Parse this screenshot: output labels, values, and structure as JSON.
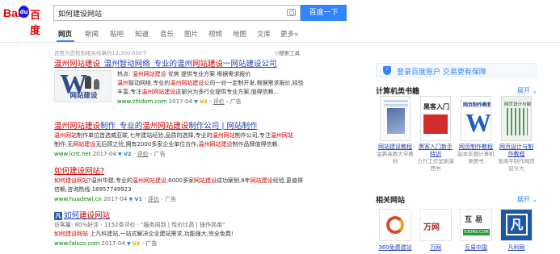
{
  "header": {
    "logo_left": "Bai",
    "logo_paw": "du",
    "logo_right": "百度",
    "search_value": "如何建设网站",
    "search_button": "百度一下",
    "tabs": [
      "网页",
      "新闻",
      "贴吧",
      "知道",
      "音乐",
      "图片",
      "视频",
      "地图",
      "文库",
      "更多»"
    ]
  },
  "meta": {
    "result_count": "百度为您找到相关结果约12,300,000个",
    "search_tools": "搜索工具"
  },
  "results": [
    {
      "title_parts": [
        "温州网站建设",
        "_温州智动网络_专业的温州",
        "网站建设",
        "一网站建设公司"
      ],
      "image_caption": "网站建设",
      "desc_hot_label": "热点:",
      "desc_hot": "温州网站建设",
      "desc_tail": "优势  提供专业方案  根据需求报价",
      "desc_line2_a": "温州",
      "desc_line2_b": "智动网络,专业的",
      "desc_line2_c": "温州网站建设",
      "desc_line2_d": "公司一对一定制开发,根据需求报价,经验",
      "desc_line3_a": "丰富,专注",
      "desc_line3_b": "温州网站建设",
      "desc_line3_c": "这部分为多行业提供专业方案,值得信赖...",
      "url": "www.zhidom.com",
      "date": "2017-04",
      "v_label": "V2",
      "eval": "评价",
      "ad": "广告"
    },
    {
      "title_a": "温州网站建设",
      "title_b": "制作_专业的",
      "title_c": "温州网站建设",
      "title_d": "制作公司 | 网站制作",
      "desc_line1_a": "温州网站",
      "desc_line1_b": "制作单位首选威亚联,七年建站经验,品质的选择,专业的",
      "desc_line1_c": "温州网站",
      "desc_line1_d": "制作公司,专注",
      "desc_line1_e": "温州网站",
      "desc_line2_a": "制作,无",
      "desc_line2_b": "网站建设",
      "desc_line2_c": "无后顾之忧,拥有2000多家企业单位合作,",
      "desc_line2_d": "温州网站建设",
      "desc_line2_e": "制作品牌值得信赖.",
      "url": "www.lcnt.net",
      "date": "2017-04",
      "v_label": "V2",
      "eval": "评价",
      "ad": "广告"
    },
    {
      "title": "如何建设网站?",
      "desc_line1_a": "如何建设网站",
      "desc_line1_b": "?温州华建,专业的",
      "desc_line1_c": "温州网站建设",
      "desc_line1_d": ",6000多家",
      "desc_line1_e": "网站建设",
      "desc_line1_f": "成功案例,8年",
      "desc_line1_g": "网站建设",
      "desc_line1_h": "经验,更值得",
      "desc_line2": "信赖,咨询热线:18957749923",
      "url": "www.huadewl.cn",
      "date": "2017-04",
      "v_label": "V1",
      "eval": "评价",
      "ad": "广告"
    },
    {
      "title_a": "如何",
      "title_b": "建设网站",
      "desc_line1": "访客量: 80%好评 · 1152条评价 · \"服务周到 | 性价比高 | 操作简单\"",
      "desc_line2_a": "如何建设网站",
      "desc_line2_b": " 上凡科建站,一站式解决企业建站需求,功能强大,完全免费!",
      "url": "www.faisco.com",
      "date": "2017-04",
      "v_label": "V2",
      "ad": "广告"
    }
  ],
  "right": {
    "login_text": "登录百度账户 交易更有保障",
    "books_title": "计算机类书籍",
    "expand_label": "展开",
    "books": [
      {
        "title": "网站建设教程",
        "sub": "金鹏高教大学教材"
      },
      {
        "title": "黑客入门新手特训",
        "sub": "力行工作室新課团书"
      },
      {
        "title": "网页制作教程",
        "sub": "起本年题计算机类图书"
      },
      {
        "title": "网页设计与制作教程",
        "sub": "张周平制作网页设计大"
      }
    ],
    "book_covers": {
      "b2_text": "黑客入门",
      "b3_text": "网页制作教程",
      "b4_text": "网页设计与制作教程"
    },
    "sites_title": "相关网站",
    "sites": [
      {
        "label": "360免费建站",
        "logo": ""
      },
      {
        "label": "万网",
        "logo": "万网"
      },
      {
        "label": "互易中国",
        "logo": "互易"
      },
      {
        "label": "凡科网",
        "logo": "凡"
      }
    ],
    "hu_badge": "53DNS.COM"
  }
}
